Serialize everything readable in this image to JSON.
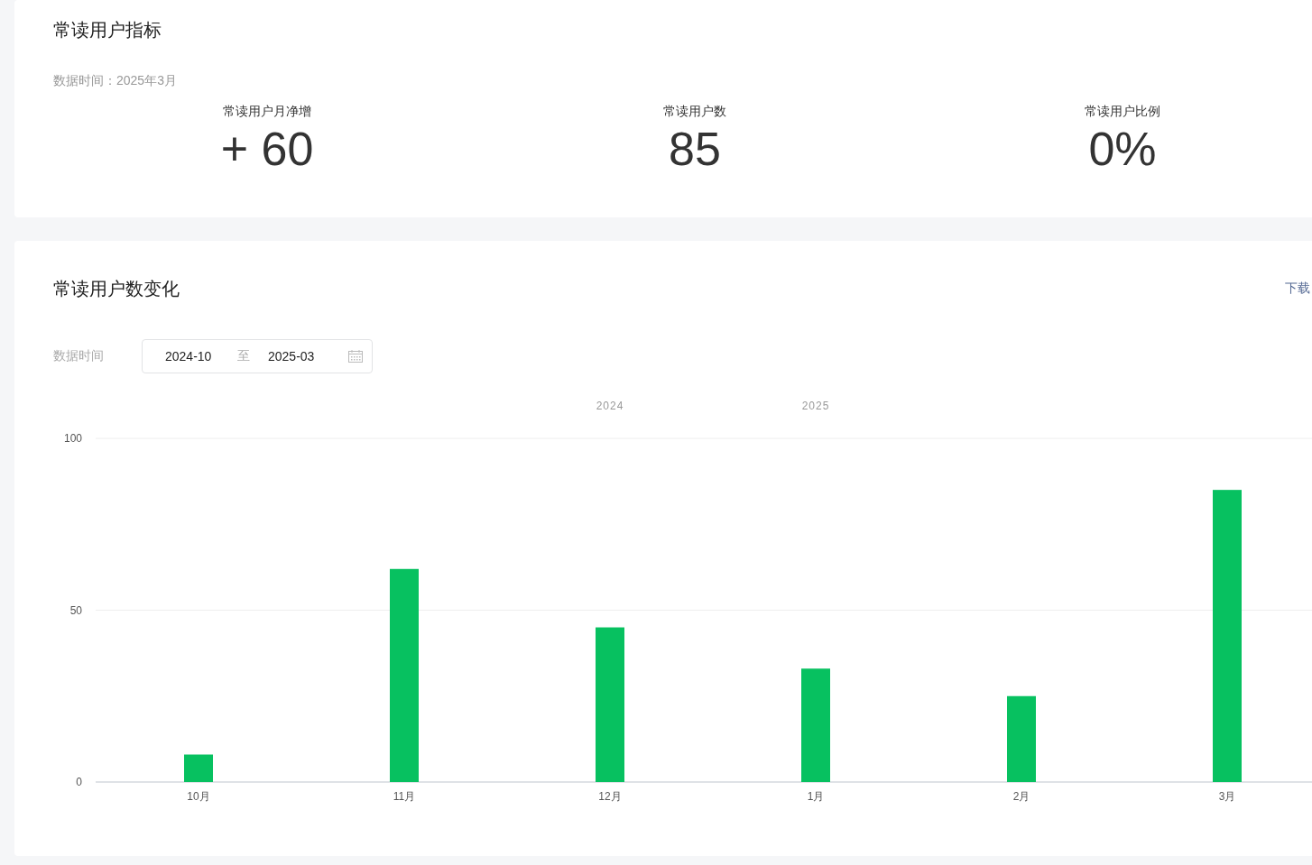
{
  "metrics_card": {
    "title": "常读用户指标",
    "data_time": "数据时间：2025年3月",
    "metrics": [
      {
        "label": "常读用户月净增",
        "value": "+ 60"
      },
      {
        "label": "常读用户数",
        "value": "85"
      },
      {
        "label": "常读用户比例",
        "value": "0%"
      }
    ]
  },
  "trend_card": {
    "title": "常读用户数变化",
    "download_link": "下载",
    "date_label": "数据时间",
    "date_range": {
      "start": "2024-10",
      "separator": "至",
      "end": "2025-03"
    },
    "chart_data": {
      "type": "bar",
      "categories": [
        "10月",
        "11月",
        "12月",
        "1月",
        "2月",
        "3月"
      ],
      "series": [
        {
          "color": "#07c160",
          "values": [
            8,
            62,
            45,
            33,
            25,
            85
          ]
        }
      ],
      "ylim": [
        0,
        100
      ],
      "yticks": [
        0,
        50,
        100
      ],
      "annotations": [
        "2024",
        "2025"
      ]
    }
  }
}
